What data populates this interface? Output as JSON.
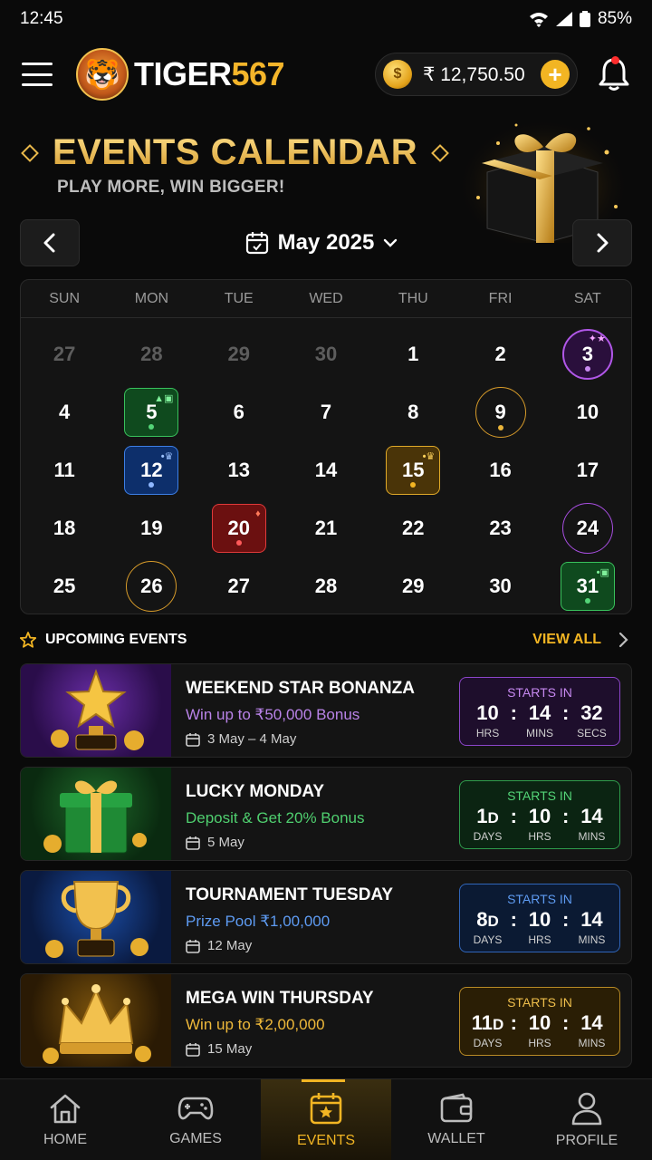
{
  "status": {
    "time": "12:45",
    "battery": "85%"
  },
  "header": {
    "brand_white": "TIGER",
    "brand_gold": "567",
    "balance": "₹ 12,750.50"
  },
  "hero": {
    "title": "EVENTS CALENDAR",
    "subtitle": "PLAY MORE, WIN BIGGER!"
  },
  "calendar": {
    "month_label": "May 2025",
    "weekdays": [
      "SUN",
      "MON",
      "TUE",
      "WED",
      "THU",
      "FRI",
      "SAT"
    ],
    "days": [
      "27",
      "28",
      "29",
      "30",
      "1",
      "2",
      "3",
      "4",
      "5",
      "6",
      "7",
      "8",
      "9",
      "10",
      "11",
      "12",
      "13",
      "14",
      "15",
      "16",
      "17",
      "18",
      "19",
      "20",
      "21",
      "22",
      "23",
      "24",
      "25",
      "26",
      "27",
      "28",
      "29",
      "30",
      "31"
    ]
  },
  "upcoming": {
    "heading": "UPCOMING EVENTS",
    "view_all": "VIEW ALL",
    "starts_in": "STARTS IN",
    "events": [
      {
        "title": "WEEKEND STAR BONANZA",
        "desc": "Win up to ₹50,000 Bonus",
        "date": "3 May – 4 May",
        "t1": "10",
        "l1": "HRS",
        "t2": "14",
        "l2": "MINS",
        "t3": "32",
        "l3": "SECS",
        "accent": "#b983e8"
      },
      {
        "title": "LUCKY MONDAY",
        "desc": "Deposit & Get 20% Bonus",
        "date": "5 May",
        "t1": "1",
        "t1s": "D",
        "l1": "DAYS",
        "t2": "10",
        "l2": "HRS",
        "t3": "14",
        "l3": "MINS",
        "accent": "#4fcf6f"
      },
      {
        "title": "TOURNAMENT TUESDAY",
        "desc": "Prize Pool ₹1,00,000",
        "date": "12 May",
        "t1": "8",
        "t1s": "D",
        "l1": "DAYS",
        "t2": "10",
        "l2": "HRS",
        "t3": "14",
        "l3": "MINS",
        "accent": "#5e9bf2"
      },
      {
        "title": "MEGA WIN THURSDAY",
        "desc": "Win up to ₹2,00,000",
        "date": "15 May",
        "t1": "11",
        "t1s": "D",
        "l1": "DAYS",
        "t2": "10",
        "l2": "HRS",
        "t3": "14",
        "l3": "MINS",
        "accent": "#efb93a"
      }
    ]
  },
  "bottom_nav": {
    "home": "HOME",
    "games": "GAMES",
    "events": "EVENTS",
    "wallet": "WALLET",
    "profile": "PROFILE"
  }
}
